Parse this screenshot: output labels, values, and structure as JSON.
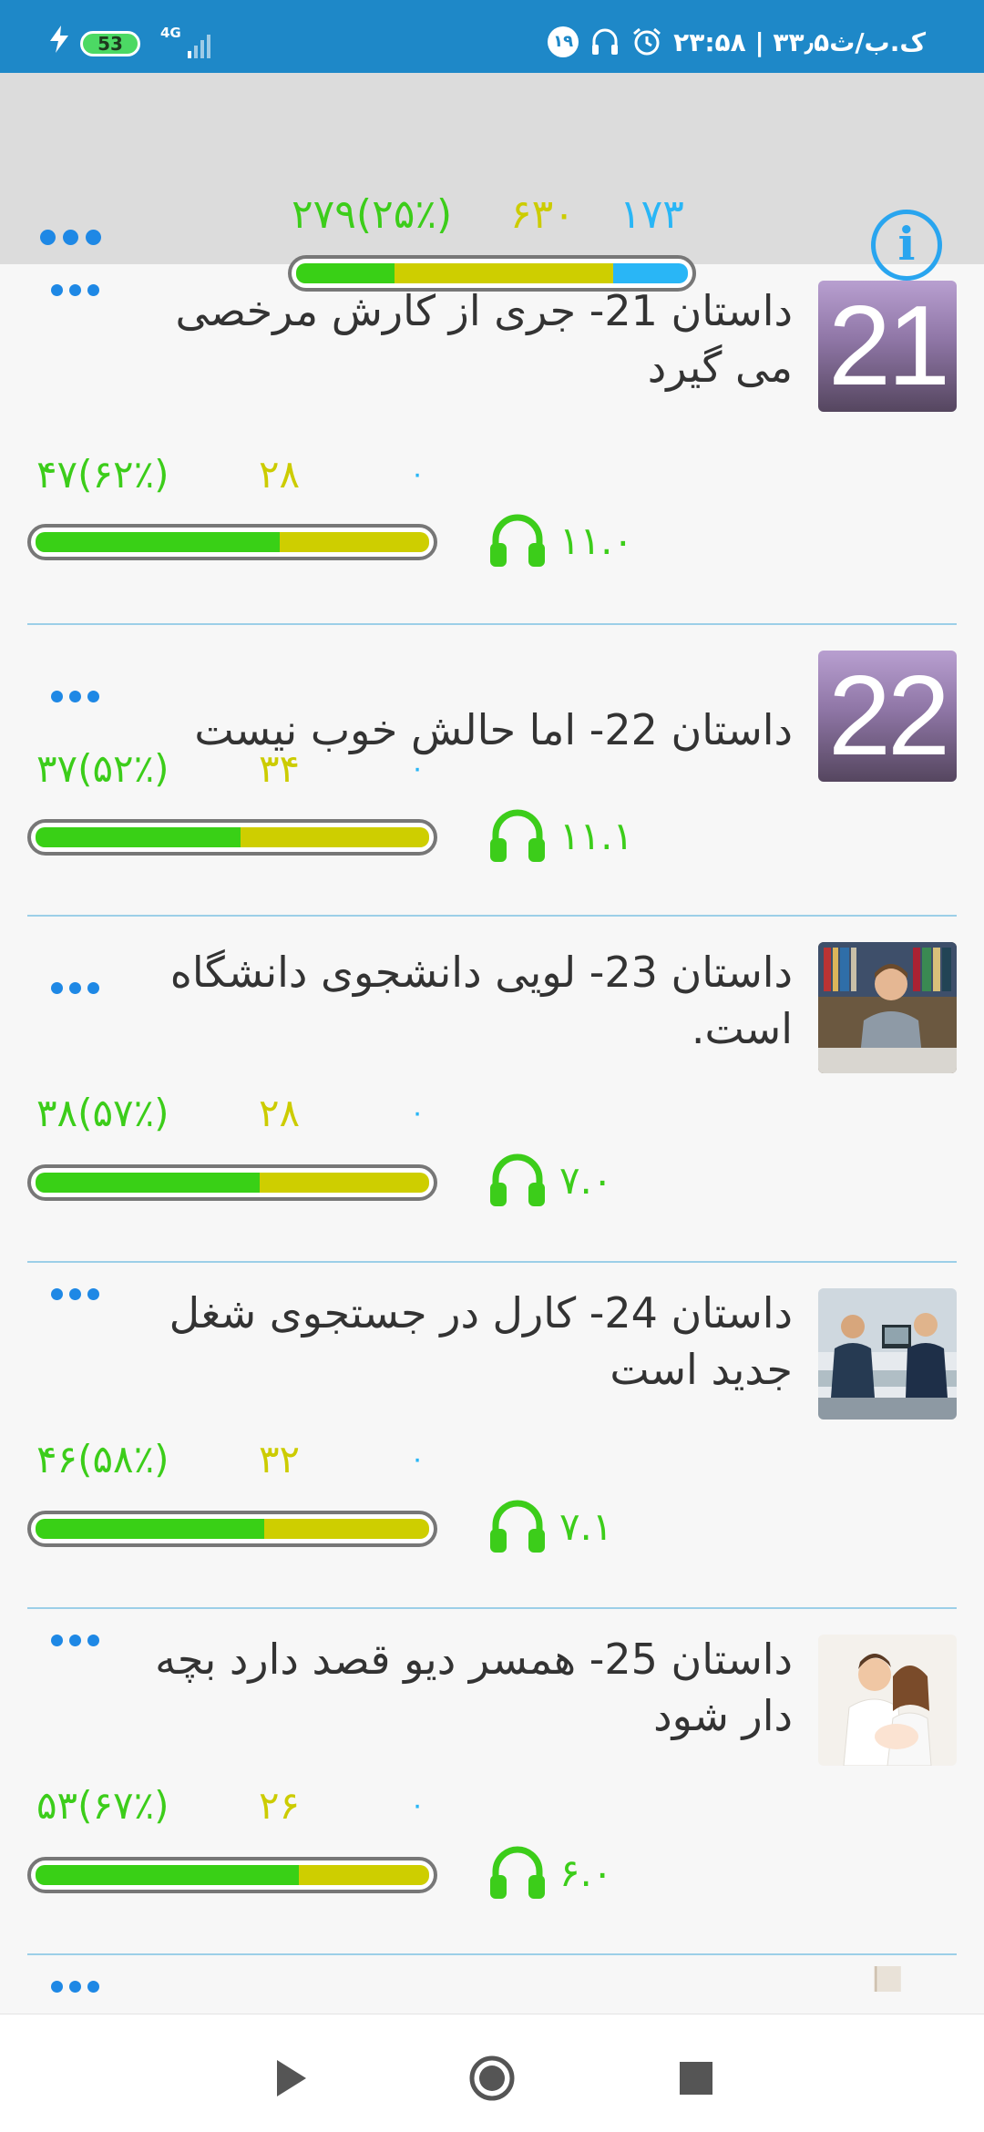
{
  "status_bar": {
    "battery_level": "53",
    "network_type": "4G",
    "notification_count": "۱۹",
    "time_text": "۲۳:۵۸ | ۳۳٫۵ک.ب/ث"
  },
  "summary": {
    "green_stat": "۲۷۹(۲۵٪)",
    "yellow_stat": "۶۳۰",
    "blue_stat": "۱۷۳",
    "bar_fractions": {
      "green": 0.25,
      "yellow": 0.56,
      "blue": 0.19
    },
    "info_symbol": "i"
  },
  "stories": [
    {
      "badge_number": "21",
      "thumb_type": "number",
      "title": "داستان 21- جری از کارش مرخصی می گیرد",
      "green_stat": "۴۷(۶۲٪)",
      "yellow_stat": "۲۸",
      "blue_stat": "۰",
      "duration": "۱۱.۰",
      "bar_fractions": {
        "green": 0.62,
        "yellow": 0.38
      }
    },
    {
      "badge_number": "22",
      "thumb_type": "number",
      "title": "داستان 22- اما حالش خوب نیست",
      "green_stat": "۳۷(۵۲٪)",
      "yellow_stat": "۳۴",
      "blue_stat": "۰",
      "duration": "۱۱.۱",
      "bar_fractions": {
        "green": 0.52,
        "yellow": 0.48
      }
    },
    {
      "thumb_type": "photo",
      "title": "داستان 23- لویی  دانشجوی دانشگاه است.",
      "green_stat": "۳۸(۵۷٪)",
      "yellow_stat": "۲۸",
      "blue_stat": "۰",
      "duration": "۷.۰",
      "bar_fractions": {
        "green": 0.57,
        "yellow": 0.43
      }
    },
    {
      "thumb_type": "photo",
      "title": "داستان 24- کارل در جستجوی شغل جدید است",
      "green_stat": "۴۶(۵۸٪)",
      "yellow_stat": "۳۲",
      "blue_stat": "۰",
      "duration": "۷.۱",
      "bar_fractions": {
        "green": 0.58,
        "yellow": 0.42
      }
    },
    {
      "thumb_type": "photo",
      "title": "داستان 25- همسر دیو قصد دارد بچه دار شود",
      "green_stat": "۵۳(۶۷٪)",
      "yellow_stat": "۲۶",
      "blue_stat": "۰",
      "duration": "۶.۰",
      "bar_fractions": {
        "green": 0.67,
        "yellow": 0.33
      }
    }
  ],
  "colors": {
    "status_bar": "#1e88c8",
    "header": "#dcdcdc",
    "green": "#3ccd1a",
    "yellow": "#cccc00",
    "blue": "#29b6f6",
    "accent_blue": "#1e88e5"
  },
  "icons": {
    "menu": "more-dots-icon",
    "info": "info-icon",
    "listen": "headphones-icon",
    "play": "play-icon",
    "record": "record-icon",
    "stop": "stop-icon"
  }
}
